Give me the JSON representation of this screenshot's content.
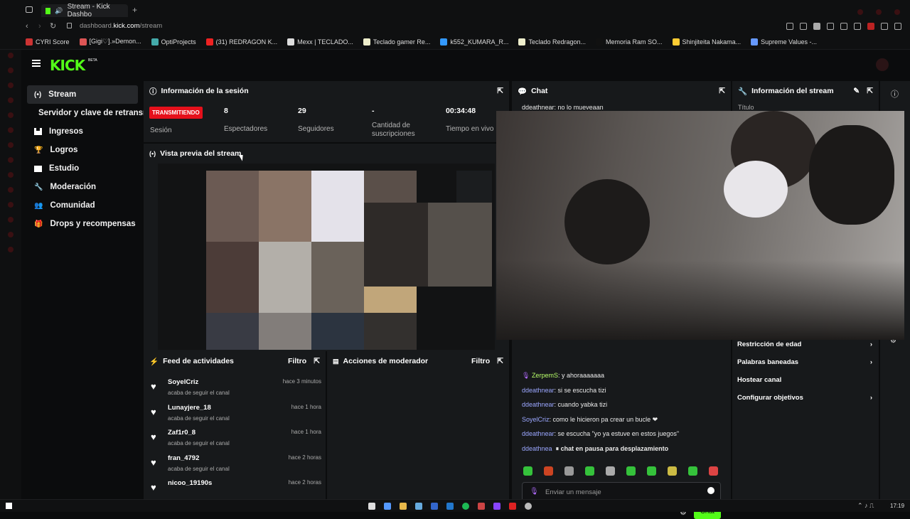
{
  "browser": {
    "tab_title": "Stream - Kick Dashbo",
    "url_prefix": "dashboard.",
    "url_domain": "kick.com",
    "url_path": "/stream",
    "bookmarks": [
      {
        "label": "CYRI Score",
        "color": "#c33"
      },
      {
        "label": "[Gigi♡].»Demon...",
        "color": "#d55"
      },
      {
        "label": "OptiProjects",
        "color": "#4aa"
      },
      {
        "label": "(31) REDRAGON K...",
        "color": "#e22"
      },
      {
        "label": "Mexx | TECLADO...",
        "color": "#ddd"
      },
      {
        "label": "Teclado gamer Re...",
        "color": "#eec"
      },
      {
        "label": "k552_KUMARA_R...",
        "color": "#39f"
      },
      {
        "label": "Teclado Redragon...",
        "color": "#eec"
      },
      {
        "label": "Memoria Ram SO...",
        "color": "#111"
      },
      {
        "label": "Shinjiteita Nakama...",
        "color": "#fc3"
      },
      {
        "label": "Supreme Values -...",
        "color": "#69f"
      }
    ]
  },
  "brand": {
    "logo": "KICK",
    "beta": "BETA",
    "accent": "#53fc18"
  },
  "sidebar": {
    "items": [
      {
        "label": "Stream",
        "icon": "broadcast-icon",
        "active": true
      },
      {
        "label": "Servidor y clave de retransmisión",
        "icon": "",
        "active": false
      },
      {
        "label": "Ingresos",
        "icon": "bars-icon"
      },
      {
        "label": "Logros",
        "icon": "trophy-icon"
      },
      {
        "label": "Estudio",
        "icon": "studio-icon",
        "chevron": "⌄"
      },
      {
        "label": "Moderación",
        "icon": "wrench-icon"
      },
      {
        "label": "Comunidad",
        "icon": "people-icon",
        "chevron": "⌄"
      },
      {
        "label": "Drops y recompensas",
        "icon": "gift-icon"
      }
    ]
  },
  "session": {
    "title": "Información de la sesión",
    "badge": "TRANSMITIENDO",
    "badge_label": "Sesión",
    "stats": [
      {
        "value": "8",
        "label": "Espectadores"
      },
      {
        "value": "29",
        "label": "Seguidores"
      },
      {
        "value": "-",
        "label": "Cantidad de suscripciones"
      },
      {
        "value": "00:34:48",
        "label": "Tiempo en vivo"
      }
    ]
  },
  "preview": {
    "title": "Vista previa del stream"
  },
  "feed": {
    "title": "Feed de actividades",
    "filter": "Filtro",
    "items": [
      {
        "name": "SoyelCriz",
        "sub": "acaba de seguir el canal",
        "time": "hace 3 minutos"
      },
      {
        "name": "Lunayjere_18",
        "sub": "acaba de seguir el canal",
        "time": "hace 1 hora"
      },
      {
        "name": "Zaf1r0_8",
        "sub": "acaba de seguir el canal",
        "time": "hace 1 hora"
      },
      {
        "name": "fran_4792",
        "sub": "acaba de seguir el canal",
        "time": "hace 2 horas"
      },
      {
        "name": "nicoo_19190s",
        "sub": "",
        "time": "hace 2 horas"
      }
    ]
  },
  "modactions": {
    "title": "Acciones de moderador",
    "filter": "Filtro"
  },
  "chat": {
    "title": "Chat",
    "top_line": {
      "user": "ddeathnear",
      "text": ": no lo mueveaan"
    },
    "lines": [
      {
        "user": "ZerpemS",
        "text": ": y ahoraaaaaaa",
        "green": true
      },
      {
        "user": "ddeathnear",
        "text": ": si se escucha tizi"
      },
      {
        "user": "ddeathnear",
        "text": ": cuando yabka tizi"
      },
      {
        "user": "SoyelCriz",
        "text": ": como le hicieron pa crear un bucle ❤"
      },
      {
        "user": "ddeathnear",
        "text": ": se escucha \"yo ya estuve en estos juegos\""
      },
      {
        "user": "ddeathnea",
        "text": "⏸ chat en pausa para desplazamiento"
      }
    ],
    "placeholder": "Enviar un mensaje",
    "send_label": "Chat"
  },
  "streaminfo": {
    "title": "Información del stream",
    "top_label": "Título",
    "rows": [
      {
        "label": "Restricción de edad",
        "arrow": true
      },
      {
        "label": "Palabras baneadas",
        "arrow": true
      },
      {
        "label": "Hostear canal",
        "arrow": false
      },
      {
        "label": "Configurar objetivos",
        "arrow": true
      }
    ]
  },
  "clock": "17:19"
}
